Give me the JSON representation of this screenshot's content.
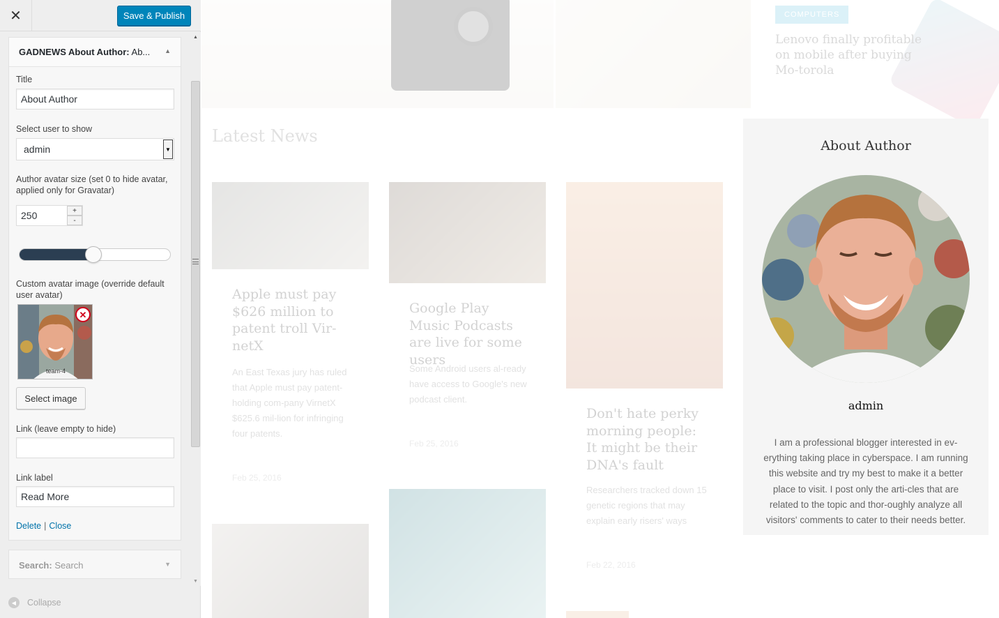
{
  "customizer": {
    "close_glyph": "✕",
    "save_button": "Save & Publish",
    "widget": {
      "title_bold": "GADNEWS About Author:",
      "title_rest": " Ab...",
      "title_label": "Title",
      "title_value": "About Author",
      "user_label": "Select user to show",
      "user_value": "admin",
      "avatar_size_label": "Author avatar size (set 0 to hide avatar, applied only for Gravatar)",
      "avatar_size_value": "250",
      "avatar_size_slider_fraction": 0.49,
      "custom_avatar_label": "Custom avatar image (override default user avatar)",
      "avatar_file_caption": "team-4",
      "select_image_button": "Select image",
      "link_label": "Link (leave empty to hide)",
      "link_value": "",
      "link_label_label": "Link label",
      "link_label_value": "Read More",
      "delete_link": "Delete",
      "separator": "|",
      "close_link": "Close"
    },
    "search_widget": {
      "title_bold": "Search:",
      "title_rest": " Search"
    },
    "collapse_label": "Collapse"
  },
  "preview": {
    "hero_category": "COMPUTERS",
    "hero_title": "Lenovo finally profitable on mobile after buying Mo-torola",
    "section_title": "Latest News",
    "cards": [
      {
        "title": "Apple must pay $626 million to patent troll Vir-netX",
        "excerpt": "An East Texas jury has ruled that Apple must pay patent-holding com-pany VirnetX $625.6 mil-lion for infringing four patents.",
        "date": "Feb 25, 2016"
      },
      {
        "title": "Google Play Music Podcasts are live for some users",
        "excerpt": "Some Android users al-ready have access to Google's new podcast client.",
        "date": "Feb 25, 2016"
      },
      {
        "title": "Don't hate perky morning people: It might be their DNA's fault",
        "excerpt": "Researchers tracked down 15 genetic regions that may explain early risers' ways",
        "date": "Feb 22, 2016"
      }
    ],
    "about": {
      "title": "About Author",
      "name": "admin",
      "bio": "I am a professional blogger interested in ev-erything taking place in cyberspace. I am running this website and try my best to make it a better place to visit. I post only the arti-cles that are related to the topic and thor-oughly analyze all visitors' comments to cater to their needs better."
    }
  },
  "colors": {
    "primary_button": "#0085ba",
    "link": "#0073aa",
    "slider_fill": "#2b3e52",
    "badge": "#5bc0de",
    "remove_icon": "#d0021b"
  },
  "icons": [
    "close-icon",
    "chevron-up-icon",
    "chevron-down-icon",
    "dropdown-arrow-icon",
    "remove-icon",
    "collapse-icon",
    "scroll-up-icon",
    "scroll-down-icon",
    "scroll-grip-icon"
  ]
}
